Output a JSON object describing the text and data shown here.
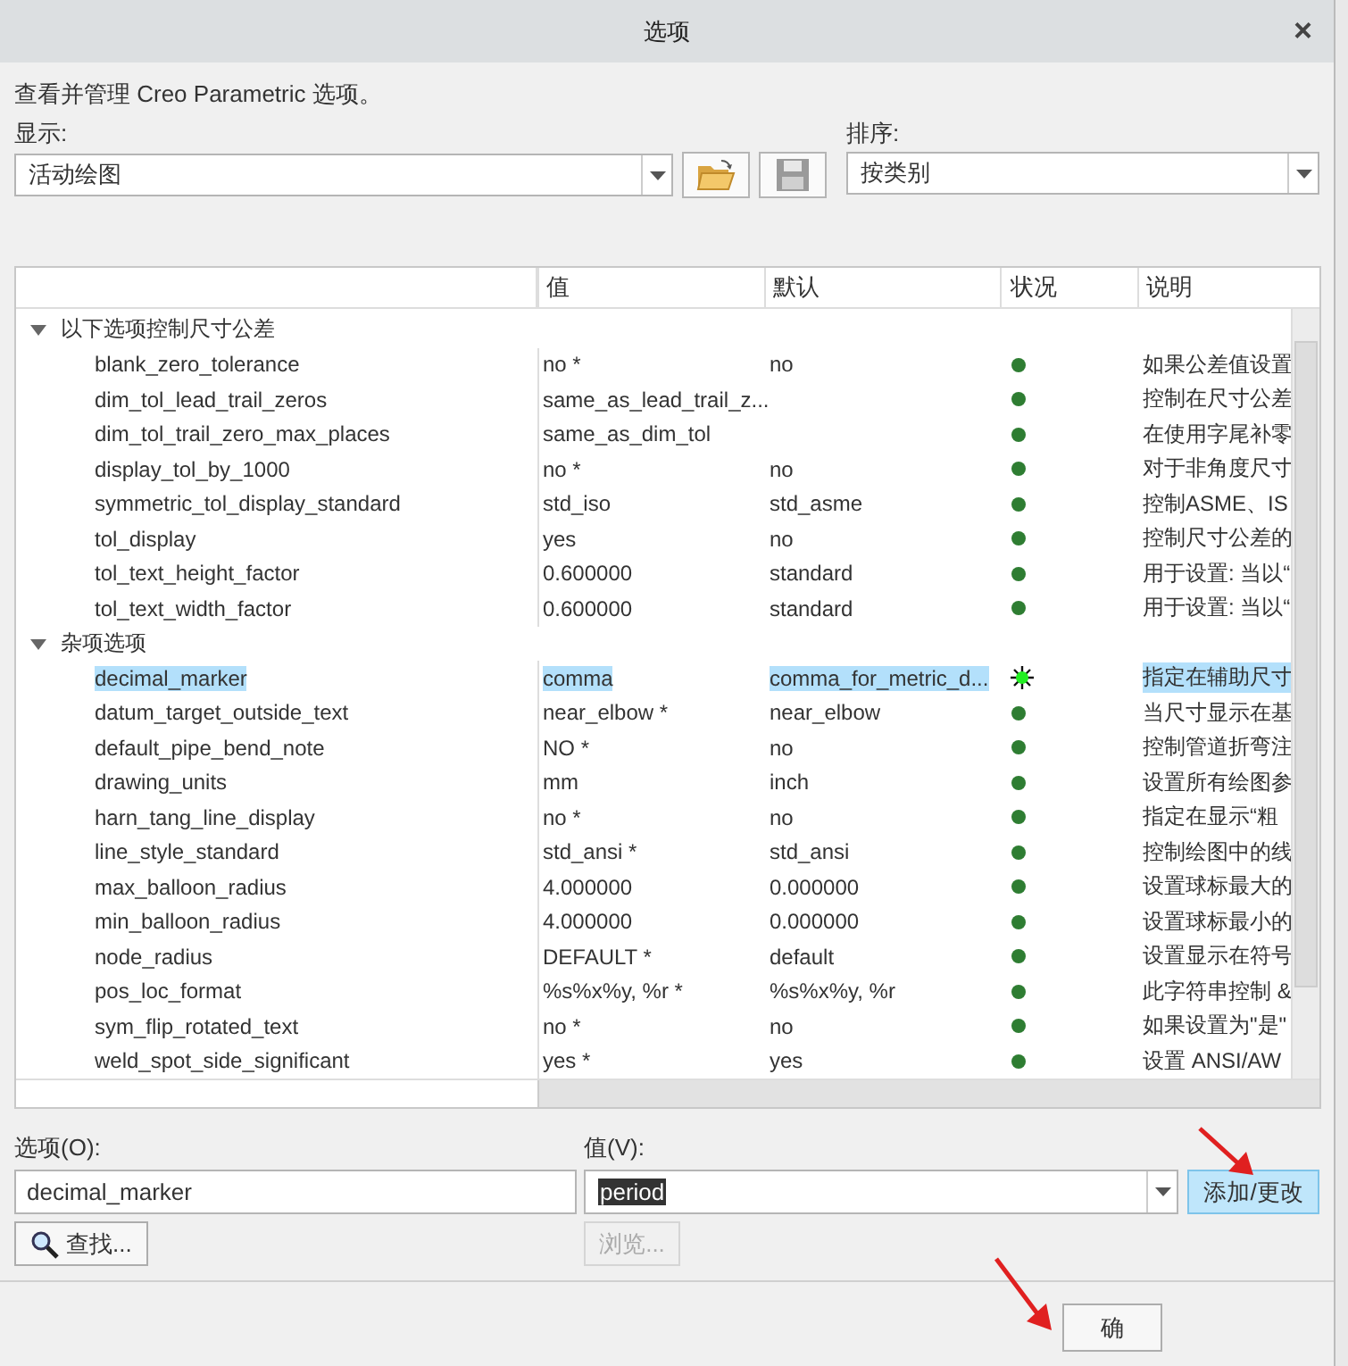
{
  "window": {
    "title": "选项",
    "close": "×"
  },
  "intro": "查看并管理 Creo Parametric 选项。",
  "display": {
    "label": "显示:",
    "value": "活动绘图"
  },
  "sort": {
    "label": "排序:",
    "value": "按类别"
  },
  "table": {
    "columns": [
      "值",
      "默认",
      "状况",
      "说明"
    ],
    "groups": [
      {
        "label": "以下选项控制尺寸公差",
        "expanded": true,
        "children": [
          {
            "name": "blank_zero_tolerance",
            "value": "no *",
            "default": "no",
            "kind": "dot",
            "description": "如果公差值设置",
            "selected": false
          },
          {
            "name": "dim_tol_lead_trail_zeros",
            "value": "same_as_lead_trail_z...",
            "kind": "dot",
            "description": "控制在尺寸公差",
            "selected": false
          },
          {
            "name": "dim_tol_trail_zero_max_places",
            "value": "same_as_dim_tol",
            "kind": "dot",
            "description": "在使用字尾补零",
            "selected": false
          },
          {
            "name": "display_tol_by_1000",
            "value": "no *",
            "default": "no",
            "kind": "dot",
            "description": "对于非角度尺寸",
            "selected": false
          },
          {
            "name": "symmetric_tol_display_standard",
            "value": "std_iso",
            "default": "std_asme",
            "kind": "dot",
            "description": "控制ASME、IS",
            "selected": false
          },
          {
            "name": "tol_display",
            "value": "yes",
            "default": "no",
            "kind": "dot",
            "description": "控制尺寸公差的",
            "selected": false
          },
          {
            "name": "tol_text_height_factor",
            "value": "0.600000",
            "default": "standard",
            "kind": "dot",
            "description": "用于设置: 当以“",
            "selected": false
          },
          {
            "name": "tol_text_width_factor",
            "value": "0.600000",
            "default": "standard",
            "kind": "dot",
            "description": "用于设置: 当以“",
            "selected": false
          }
        ]
      },
      {
        "label": "杂项选项",
        "expanded": true,
        "children": [
          {
            "name": "decimal_marker",
            "value": "comma",
            "default": "comma_for_metric_d...",
            "kind": "star",
            "description": "指定在辅助尺寸",
            "selected": true
          },
          {
            "name": "datum_target_outside_text",
            "value": "near_elbow *",
            "default": "near_elbow",
            "kind": "dot",
            "description": "当尺寸显示在基",
            "selected": false
          },
          {
            "name": "default_pipe_bend_note",
            "value": "NO *",
            "default": "no",
            "kind": "dot",
            "description": "控制管道折弯注",
            "selected": false
          },
          {
            "name": "drawing_units",
            "value": "mm",
            "default": "inch",
            "kind": "dot",
            "description": "设置所有绘图参",
            "selected": false
          },
          {
            "name": "harn_tang_line_display",
            "value": "no *",
            "default": "no",
            "kind": "dot",
            "description": "指定在显示“粗",
            "selected": false
          },
          {
            "name": "line_style_standard",
            "value": "std_ansi *",
            "default": "std_ansi",
            "kind": "dot",
            "description": "控制绘图中的线",
            "selected": false
          },
          {
            "name": "max_balloon_radius",
            "value": "4.000000",
            "default": "0.000000",
            "kind": "dot",
            "description": "设置球标最大的",
            "selected": false
          },
          {
            "name": "min_balloon_radius",
            "value": "4.000000",
            "default": "0.000000",
            "kind": "dot",
            "description": "设置球标最小的",
            "selected": false
          },
          {
            "name": "node_radius",
            "value": "DEFAULT *",
            "default": "default",
            "kind": "dot",
            "description": "设置显示在符号",
            "selected": false
          },
          {
            "name": "pos_loc_format",
            "value": "%s%x%y, %r *",
            "default": "%s%x%y, %r",
            "kind": "dot",
            "description": "此字符串控制 &",
            "selected": false
          },
          {
            "name": "sym_flip_rotated_text",
            "value": "no *",
            "default": "no",
            "kind": "dot",
            "description": "如果设置为\"是\"",
            "selected": false
          },
          {
            "name": "weld_spot_side_significant",
            "value": "yes *",
            "default": "yes",
            "kind": "dot",
            "description": "设置 ANSI/AW",
            "selected": false
          }
        ]
      }
    ]
  },
  "option_field": {
    "label": "选项(O):",
    "value": "decimal_marker"
  },
  "value_field": {
    "label": "值(V):",
    "value": "period"
  },
  "buttons": {
    "add": "添加/更改",
    "find": "查找...",
    "browse": "浏览...",
    "browse_disabled": true,
    "ok": "确"
  }
}
